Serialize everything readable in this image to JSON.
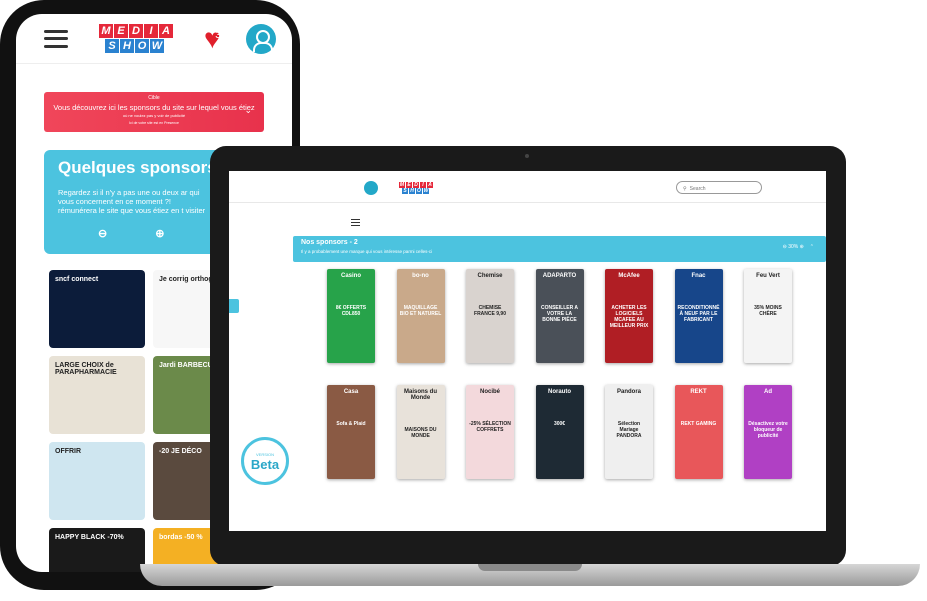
{
  "colors": {
    "accent": "#4cc3df",
    "brand_red": "#e5283a",
    "brand_blue": "#2a82d0"
  },
  "logo": {
    "line1": [
      "M",
      "E",
      "D",
      "I",
      "A"
    ],
    "line2": [
      "S",
      "H",
      "O",
      "W"
    ]
  },
  "phone": {
    "favorites_count": "3",
    "banner": {
      "small": "Cible",
      "main": "Vous découvrez ici les sponsors du site sur lequel vous étiez",
      "sub": "où ne voulez pas y voir de publicité",
      "foot": "Ici de votre site est en Presence"
    },
    "sponsors": {
      "title": "Quelques sponsors",
      "desc": "Regardez si il n'y a pas une ou deux ar qui vous concernent en ce moment ?! rémunérera le site que vous étiez en t visiter",
      "zoom_out": "⊖",
      "zoom_in": "⊕"
    },
    "tiles": [
      {
        "label": "sncf connect",
        "bg": "#0c1c3a"
      },
      {
        "label": "Je corrig orthogr et mon",
        "bg": "#f7f7f7",
        "dark": true
      },
      {
        "label": "LARGE CHOIX de PARAPHARMACIE",
        "bg": "#e8e2d6",
        "dark": true
      },
      {
        "label": "Jardi BARBECUE &",
        "bg": "#6b8a4a"
      },
      {
        "label": "OFFRIR",
        "bg": "#cfe6f0",
        "dark": true
      },
      {
        "label": "-20 JE DÉCO",
        "bg": "#5a4a3e"
      },
      {
        "label": "HAPPY BLACK -70%",
        "bg": "#1a1a1a"
      },
      {
        "label": "bordas -50 %",
        "bg": "#f4b023"
      }
    ]
  },
  "laptop": {
    "search_placeholder": "Search",
    "bar": {
      "title": "Nos sponsors - 2",
      "subtitle": "Il y a probablement une marque qui vous intéresse parmi celles-ci",
      "zoom": "⊖ 30% ⊕",
      "collapse": "⌃"
    },
    "beta": {
      "small": "VERSION",
      "label": "Beta"
    },
    "ads": [
      {
        "name": "Casino",
        "text": "8€ OFFERTS CDL850",
        "bg": "#27a34a"
      },
      {
        "name": "bo-no",
        "text": "MAQUILLAGE BIO ET NATUREL",
        "bg": "#c9a98a"
      },
      {
        "name": "Chemise",
        "text": "CHEMISE FRANCE 9,90",
        "bg": "#d9d3cf",
        "dark": true
      },
      {
        "name": "ADAPARTO",
        "text": "CONSEILLER A VOTRE LA BONNE PIÈCE",
        "bg": "#4a5058"
      },
      {
        "name": "McAfee",
        "text": "ACHETER LES LOGICIELS MCAFEE AU MEILLEUR PRIX",
        "bg": "#b01e24"
      },
      {
        "name": "Fnac",
        "text": "RECONDITIONNÉ À NEUF PAR LE FABRICANT",
        "bg": "#17468a"
      },
      {
        "name": "Feu Vert",
        "text": "35% MOINS CHÈRE",
        "bg": "#f4f4f4",
        "dark": true
      },
      {
        "name": "Casa",
        "text": "Sofa & Plaid",
        "bg": "#8a5a44"
      },
      {
        "name": "Maisons du Monde",
        "text": "MAISONS DU MONDE",
        "bg": "#e8e2da",
        "dark": true
      },
      {
        "name": "Nocibé",
        "text": "-25% SÉLECTION COFFRETS",
        "bg": "#f3d9dc",
        "dark": true
      },
      {
        "name": "Norauto",
        "text": "300€",
        "bg": "#1e2a34"
      },
      {
        "name": "Pandora",
        "text": "Sélection Mariage PANDORA",
        "bg": "#efefef",
        "dark": true
      },
      {
        "name": "REKT",
        "text": "REKT GAMING",
        "bg": "#e8575a"
      },
      {
        "name": "Ad",
        "text": "Désactivez votre bloqueur de publicité",
        "bg": "#b040c4"
      }
    ]
  }
}
